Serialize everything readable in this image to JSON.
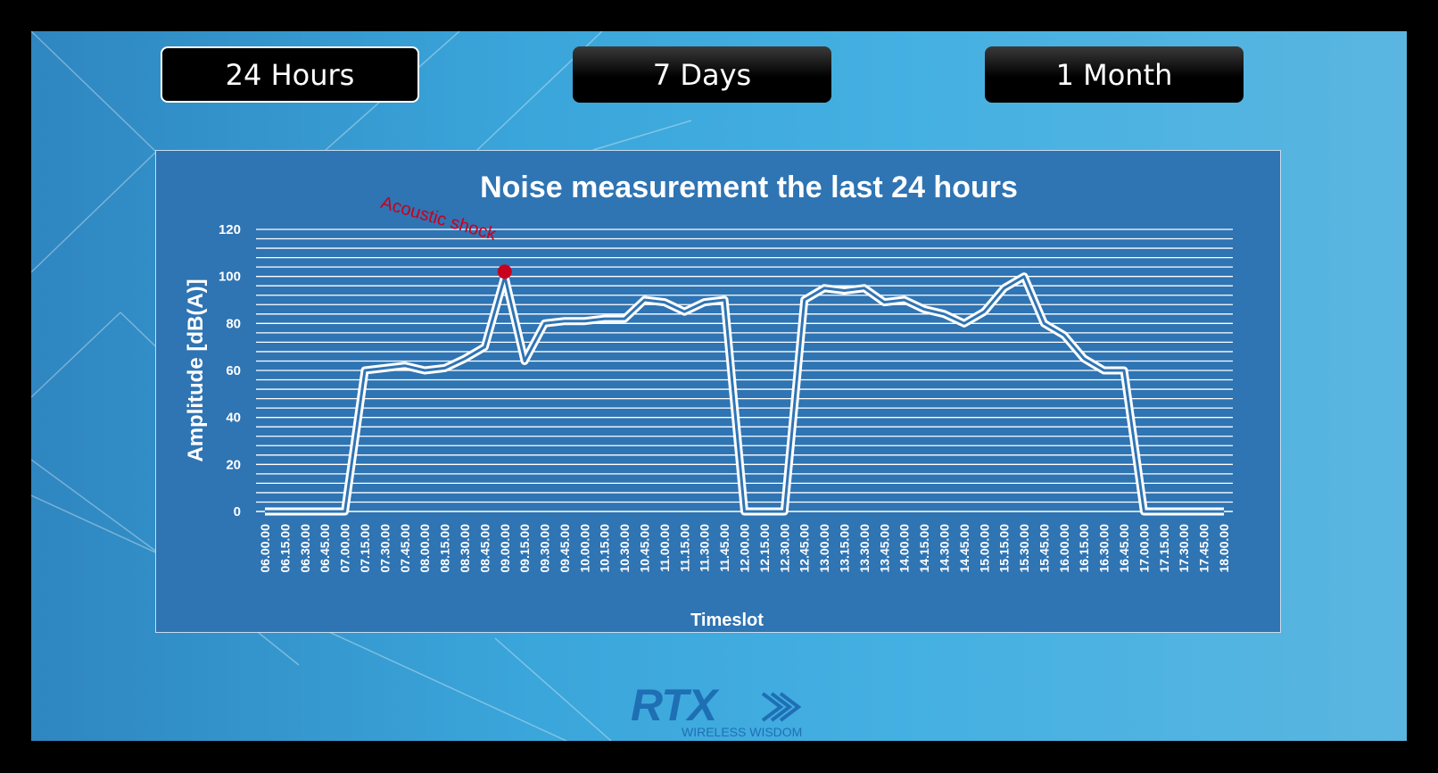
{
  "buttons": [
    {
      "label": "24 Hours",
      "active": true
    },
    {
      "label": "7 Days",
      "active": false
    },
    {
      "label": "1 Month",
      "active": false
    }
  ],
  "colors": {
    "chart_bg": "#2f74b3",
    "line": "#ffffff",
    "marker": "#c8001e",
    "annotation": "#c8001e",
    "logo": "#1f6fb5"
  },
  "logo": {
    "text": "RTX",
    "tagline": "WIRELESS WISDOM"
  },
  "chart_data": {
    "type": "line",
    "title": "Noise measurement the last 24 hours",
    "xlabel": "Timeslot",
    "ylabel": "Amplitude [dB(A)]",
    "ylim": [
      0,
      120
    ],
    "yticks": [
      0,
      20,
      40,
      60,
      80,
      100,
      120
    ],
    "grid": true,
    "x": [
      "06.00.00",
      "06.15.00",
      "06.30.00",
      "06.45.00",
      "07.00.00",
      "07.15.00",
      "07.30.00",
      "07.45.00",
      "08.00.00",
      "08.15.00",
      "08.30.00",
      "08.45.00",
      "09.00.00",
      "09.15.00",
      "09.30.00",
      "09.45.00",
      "10.00.00",
      "10.15.00",
      "10.30.00",
      "10.45.00",
      "11.00.00",
      "11.15.00",
      "11.30.00",
      "11.45.00",
      "12.00.00",
      "12.15.00",
      "12.30.00",
      "12.45.00",
      "13.00.00",
      "13.15.00",
      "13.30.00",
      "13.45.00",
      "14.00.00",
      "14.15.00",
      "14.30.00",
      "14.45.00",
      "15.00.00",
      "15.15.00",
      "15.30.00",
      "15.45.00",
      "16.00.00",
      "16.15.00",
      "16.30.00",
      "16.45.00",
      "17.00.00",
      "17.15.00",
      "17.30.00",
      "17.45.00",
      "18.00.00"
    ],
    "values": [
      0,
      0,
      0,
      0,
      0,
      60,
      61,
      62,
      60,
      61,
      65,
      70,
      100,
      64,
      80,
      81,
      81,
      82,
      82,
      90,
      89,
      85,
      89,
      90,
      0,
      0,
      0,
      90,
      95,
      94,
      95,
      89,
      90,
      86,
      84,
      80,
      85,
      95,
      100,
      80,
      75,
      65,
      60,
      60,
      0,
      0,
      0,
      0,
      0
    ],
    "annotations": [
      {
        "text": "Acoustic shock",
        "x": "09.00.00",
        "y": 102
      }
    ]
  }
}
